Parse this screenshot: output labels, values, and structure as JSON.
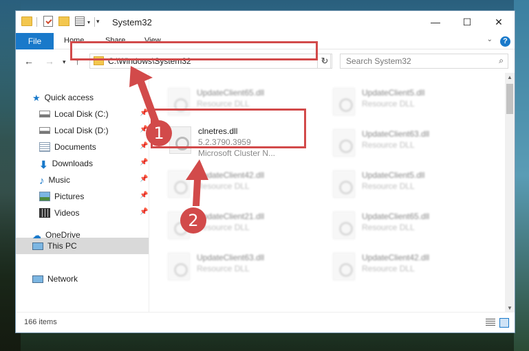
{
  "window": {
    "title": "System32",
    "controls": {
      "minimize": "—",
      "maximize": "☐",
      "close": "✕"
    }
  },
  "ribbon": {
    "tabs": [
      "File",
      "Home",
      "Share",
      "View"
    ],
    "help": "?"
  },
  "nav": {
    "address": "C:\\Windows\\System32",
    "search_placeholder": "Search System32"
  },
  "sidebar": {
    "items": [
      {
        "label": "Quick access",
        "icon": "star-icon",
        "pinned": false
      },
      {
        "label": "Local Disk (C:)",
        "icon": "drive-icon",
        "pinned": true
      },
      {
        "label": "Local Disk (D:)",
        "icon": "drive-icon",
        "pinned": true
      },
      {
        "label": "Documents",
        "icon": "documents-icon",
        "pinned": true
      },
      {
        "label": "Downloads",
        "icon": "download-icon",
        "pinned": true
      },
      {
        "label": "Music",
        "icon": "music-icon",
        "pinned": true
      },
      {
        "label": "Pictures",
        "icon": "pictures-icon",
        "pinned": true
      },
      {
        "label": "Videos",
        "icon": "videos-icon",
        "pinned": true
      },
      {
        "label": "OneDrive",
        "icon": "cloud-icon",
        "pinned": false
      },
      {
        "label": "This PC",
        "icon": "computer-icon",
        "pinned": false,
        "selected": true
      },
      {
        "label": "Network",
        "icon": "network-icon",
        "pinned": false
      }
    ]
  },
  "files": [
    {
      "name": "UpdateClient65.dll",
      "desc": "Resource DLL"
    },
    {
      "name": "UpdateClient5.dll",
      "desc": "Resource DLL"
    },
    {
      "name": "clnetres.dll",
      "desc": "5.2.3790.3959",
      "desc2": "Microsoft Cluster N..."
    },
    {
      "name": "UpdateClient63.dll",
      "desc": "Resource DLL"
    },
    {
      "name": "UpdateClient42.dll",
      "desc": "Resource DLL"
    },
    {
      "name": "UpdateClient5.dll",
      "desc": "Resource DLL"
    },
    {
      "name": "UpdateClient21.dll",
      "desc": "Resource DLL"
    },
    {
      "name": "UpdateClient65.dll",
      "desc": "Resource DLL"
    },
    {
      "name": "UpdateClient63.dll",
      "desc": "Resource DLL"
    },
    {
      "name": "UpdateClient42.dll",
      "desc": "Resource DLL"
    }
  ],
  "status": {
    "items": "166 items"
  },
  "annotations": {
    "step1": "1",
    "step2": "2",
    "color": "#d24a4a"
  }
}
